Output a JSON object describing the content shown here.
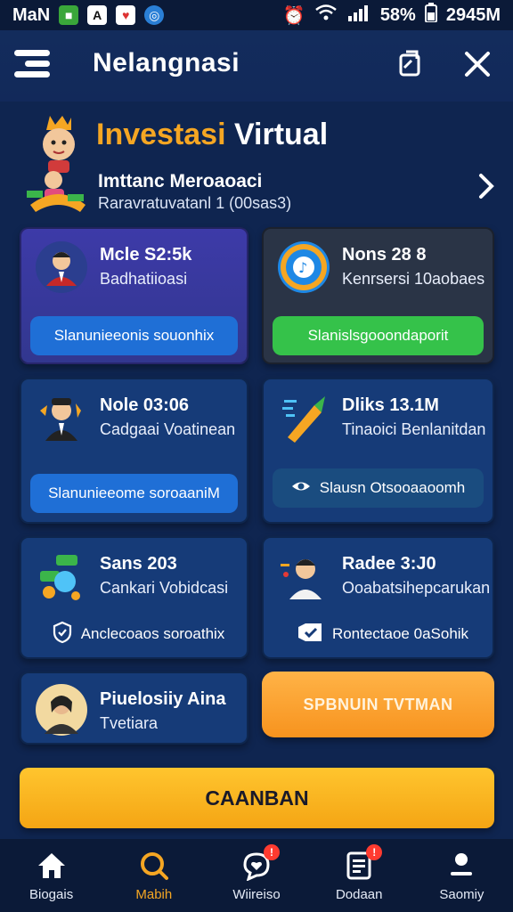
{
  "status_bar": {
    "carrier": "MaN",
    "battery_pct": "58%",
    "time": "2945M"
  },
  "header": {
    "title": "Nelangnasi",
    "title_dot": "i"
  },
  "hero": {
    "title_part1": "Investasi",
    "title_part2": " Virtual",
    "subtitle": "Imttanc Meroaoaci",
    "caption": "Raravratuvatanl 1 (00sas3)"
  },
  "cards": [
    {
      "title": "Mcle S2:5k",
      "subtitle": "Badhatiioasi",
      "action": "Slanunieeonis souonhix"
    },
    {
      "title": "Nons 28 8",
      "subtitle": "Kenrsersi 10aobaes",
      "action": "Slanislsgooondaporit"
    },
    {
      "title": "Nole 03:06",
      "subtitle": "Cadgaai Voatinean",
      "action": "Slanunieeome soroaaniM"
    },
    {
      "title": "Dliks 13.1M",
      "subtitle": "Tinaoici Benlanitdan",
      "action": "Slausn Otsooaaoomh"
    },
    {
      "title": "Sans 203",
      "subtitle": "Cankari Vobidcasi",
      "action": "Anclecoaos soroathix"
    },
    {
      "title": "Radee 3:J0",
      "subtitle": "Ooabatsihepcarukan",
      "action": "Rontectaoe 0aSohik"
    },
    {
      "title": "Piuelosiiy Aina",
      "subtitle": "Tvetiara"
    }
  ],
  "orange_button": "SPBNUIN TVTMAN",
  "main_button": "CAANBAN",
  "bottom_nav": [
    {
      "label": "Biogais"
    },
    {
      "label": "Mabih"
    },
    {
      "label": "Wiireiso"
    },
    {
      "label": "Dodaan"
    },
    {
      "label": "Saomiy"
    }
  ],
  "colors": {
    "background": "#0f2550",
    "accent_orange": "#f5a623",
    "accent_yellow": "#ffc52e",
    "button_blue": "#1f6fd6",
    "button_green": "#35c24a",
    "badge_red": "#ff3b30"
  }
}
